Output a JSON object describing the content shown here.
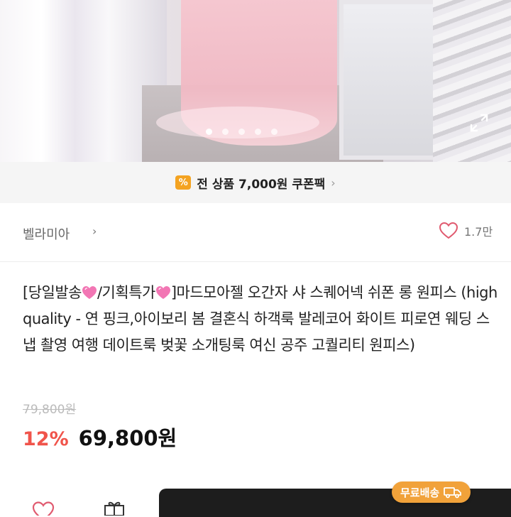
{
  "coupon": {
    "badge": "%",
    "text": "전 상품 7,000원 쿠폰팩",
    "chevron": "›"
  },
  "seller": {
    "name": "벨라미아",
    "chevron": "›",
    "likes": "1.7만"
  },
  "product": {
    "title_part1": "[당일발송",
    "title_part2": "/기획특가",
    "title_part3": "]마드모아젤 오간자 샤 스퀘어넥 쉬폰 롱 원피스 (high quality - 연 핑크,아이보리 봄 결혼식 하객룩 발레코어 화이트 피로연 웨딩 스냅 촬영 여행 데이트룩 벚꽃 소개팅룩 여신 공주 고퀄리티 원피스)",
    "original_price": "79,800원",
    "discount": "12%",
    "price": "69,800원"
  },
  "shipping_badge": "무료배송",
  "icons": {
    "expand": "expand-icon",
    "heart": "heart-icon",
    "gift": "gift-icon",
    "truck": "truck-icon",
    "title_heart": "pink-heart-emoji"
  },
  "colors": {
    "accent": "#f0544b",
    "coupon": "#f4a321",
    "shipping": "#f1a23a",
    "bar": "#1d1d1d"
  },
  "carousel": {
    "total_slides": 5,
    "active_slide": 1
  }
}
